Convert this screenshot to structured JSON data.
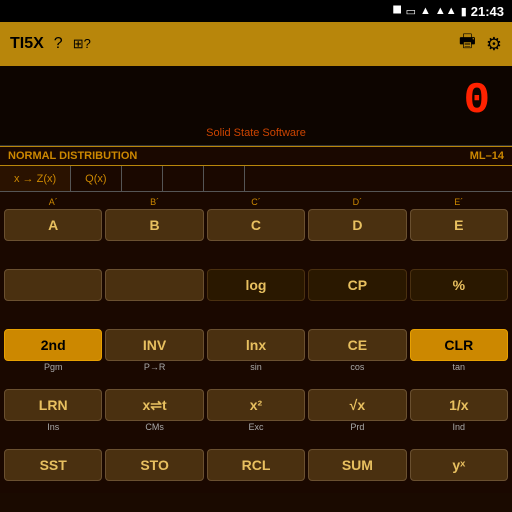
{
  "status": {
    "time": "21:43",
    "icons": [
      "bluetooth",
      "battery-outline",
      "wifi",
      "signal",
      "battery"
    ]
  },
  "titlebar": {
    "app_name": "TI5X",
    "help_label": "?",
    "modules_label": "⊞?",
    "print_label": "🖨",
    "gear_label": "⚙"
  },
  "display": {
    "number": "0",
    "brand": "Solid State Software"
  },
  "modebar": {
    "mode": "NORMAL DISTRIBUTION",
    "ml": "ML–14"
  },
  "tabs": [
    {
      "label": "x → Z(x)",
      "active": true
    },
    {
      "label": "Q(x)",
      "active": false
    },
    {
      "label": "",
      "active": false
    },
    {
      "label": "",
      "active": false
    },
    {
      "label": "",
      "active": false
    }
  ],
  "keys": [
    {
      "top": "A´",
      "main": "A",
      "bottom": "",
      "type": "normal"
    },
    {
      "top": "B´",
      "main": "B",
      "bottom": "",
      "type": "normal"
    },
    {
      "top": "C´",
      "main": "C",
      "bottom": "",
      "type": "normal"
    },
    {
      "top": "D´",
      "main": "D",
      "bottom": "",
      "type": "normal"
    },
    {
      "top": "E´",
      "main": "E",
      "bottom": "",
      "type": "normal"
    },
    {
      "top": "",
      "main": "",
      "bottom": "",
      "type": "normal"
    },
    {
      "top": "",
      "main": "",
      "bottom": "",
      "type": "normal"
    },
    {
      "top": "",
      "main": "log",
      "bottom": "",
      "type": "dark"
    },
    {
      "top": "",
      "main": "CP",
      "bottom": "",
      "type": "dark"
    },
    {
      "top": "",
      "main": "%",
      "bottom": "",
      "type": "dark"
    },
    {
      "top": "",
      "main": "2nd",
      "bottom": "Pgm",
      "type": "2nd"
    },
    {
      "top": "",
      "main": "INV",
      "bottom": "P→R",
      "type": "normal"
    },
    {
      "top": "",
      "main": "lnx",
      "bottom": "sin",
      "type": "normal"
    },
    {
      "top": "",
      "main": "CE",
      "bottom": "cos",
      "type": "normal"
    },
    {
      "top": "",
      "main": "CLR",
      "bottom": "tan",
      "type": "clr"
    },
    {
      "top": "",
      "main": "LRN",
      "bottom": "Ins",
      "type": "normal"
    },
    {
      "top": "",
      "main": "x⇌t",
      "bottom": "CMs",
      "type": "normal"
    },
    {
      "top": "",
      "main": "x²",
      "bottom": "Exc",
      "type": "normal"
    },
    {
      "top": "",
      "main": "√x",
      "bottom": "Prd",
      "type": "normal"
    },
    {
      "top": "",
      "main": "1/x",
      "bottom": "Ind",
      "type": "normal"
    },
    {
      "top": "",
      "main": "SST",
      "bottom": "",
      "type": "normal"
    },
    {
      "top": "",
      "main": "STO",
      "bottom": "",
      "type": "normal"
    },
    {
      "top": "",
      "main": "RCL",
      "bottom": "",
      "type": "normal"
    },
    {
      "top": "",
      "main": "SUM",
      "bottom": "",
      "type": "normal"
    },
    {
      "top": "",
      "main": "yˣ",
      "bottom": "",
      "type": "normal"
    }
  ]
}
